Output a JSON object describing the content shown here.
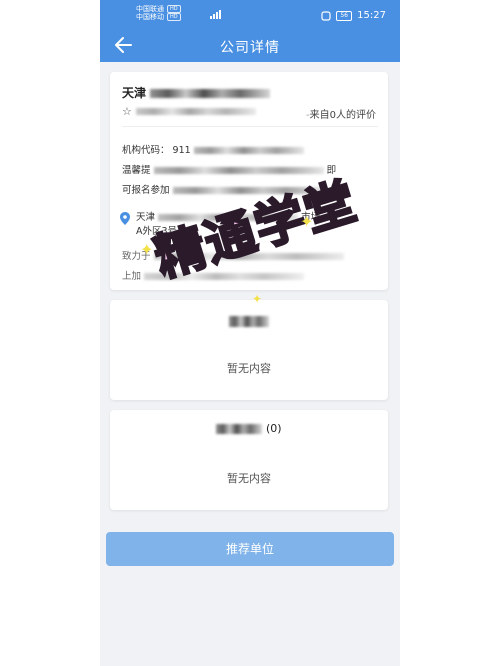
{
  "status": {
    "carrier1": "中国联通",
    "carrier2": "中国移动",
    "hd": "HD",
    "battery": "56",
    "time": "15:27"
  },
  "header": {
    "title": "公司详情"
  },
  "company": {
    "name": "天津",
    "star": "☆",
    "rating_text": "来自0人的评价",
    "code_label": "机构代码：",
    "code_value": "911",
    "tip_prefix": "温馨提",
    "tip_suffix": "即",
    "tip_line2": "可报名参加",
    "address_prefix": "天津",
    "address_suffix": "市场",
    "address_line2": "A外区3号",
    "desc_prefix": "致力于",
    "desc_line2": "上加"
  },
  "section2": {
    "empty_text": "暂无内容"
  },
  "section3": {
    "title_suffix": "(0)",
    "empty_text": "暂无内容"
  },
  "button": {
    "label": "推荐单位"
  },
  "watermark": {
    "text": "精通学堂"
  },
  "colors": {
    "header_blue": "#4a90e2",
    "button_blue": "#7fb3ea",
    "watermark_pink": "#f7c5ec"
  }
}
